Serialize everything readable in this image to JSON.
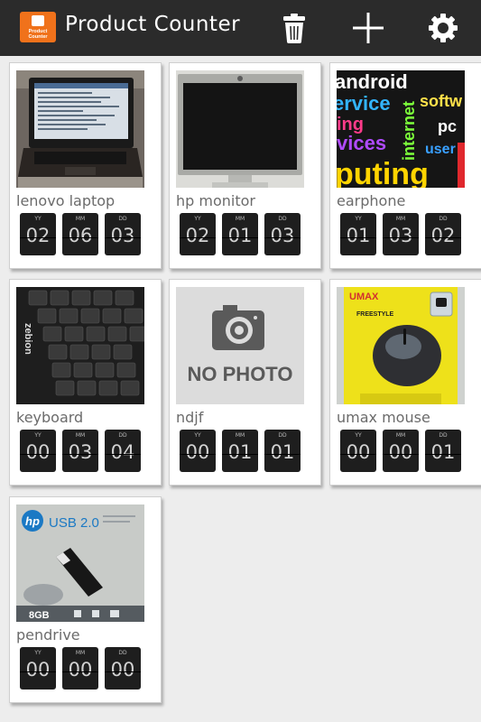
{
  "app": {
    "logo_line1": "Product",
    "logo_line2": "Counter",
    "title": "Product Counter",
    "accent_color": "#f0721b",
    "toolbar_icons": [
      "trash-icon",
      "plus-icon",
      "gear-icon"
    ]
  },
  "date_labels": {
    "yy": "YY",
    "mm": "MM",
    "dd": "DD"
  },
  "products": [
    {
      "name": "lenovo laptop",
      "yy": "02",
      "mm": "06",
      "dd": "03"
    },
    {
      "name": "hp monitor",
      "yy": "02",
      "mm": "01",
      "dd": "03"
    },
    {
      "name": "earphone",
      "yy": "01",
      "mm": "03",
      "dd": "02"
    },
    {
      "name": "keyboard",
      "yy": "00",
      "mm": "03",
      "dd": "04"
    },
    {
      "name": "ndjf",
      "yy": "00",
      "mm": "01",
      "dd": "01",
      "photo_text": "NO PHOTO"
    },
    {
      "name": "umax mouse",
      "yy": "00",
      "mm": "00",
      "dd": "01"
    },
    {
      "name": "pendrive",
      "yy": "00",
      "mm": "00",
      "dd": "00"
    }
  ],
  "photo_texts": {
    "earphone": [
      "android",
      "ervice",
      "softw",
      "internet",
      "ing",
      "pc",
      "vices",
      "user",
      "puting"
    ],
    "mouse_brand": "UMAX",
    "mouse_model": "FREESTYLE",
    "pendrive_brand": "hp",
    "pendrive_model": "USB 2.0",
    "pendrive_capacity": "8GB",
    "keyboard_brand": "zebion"
  }
}
